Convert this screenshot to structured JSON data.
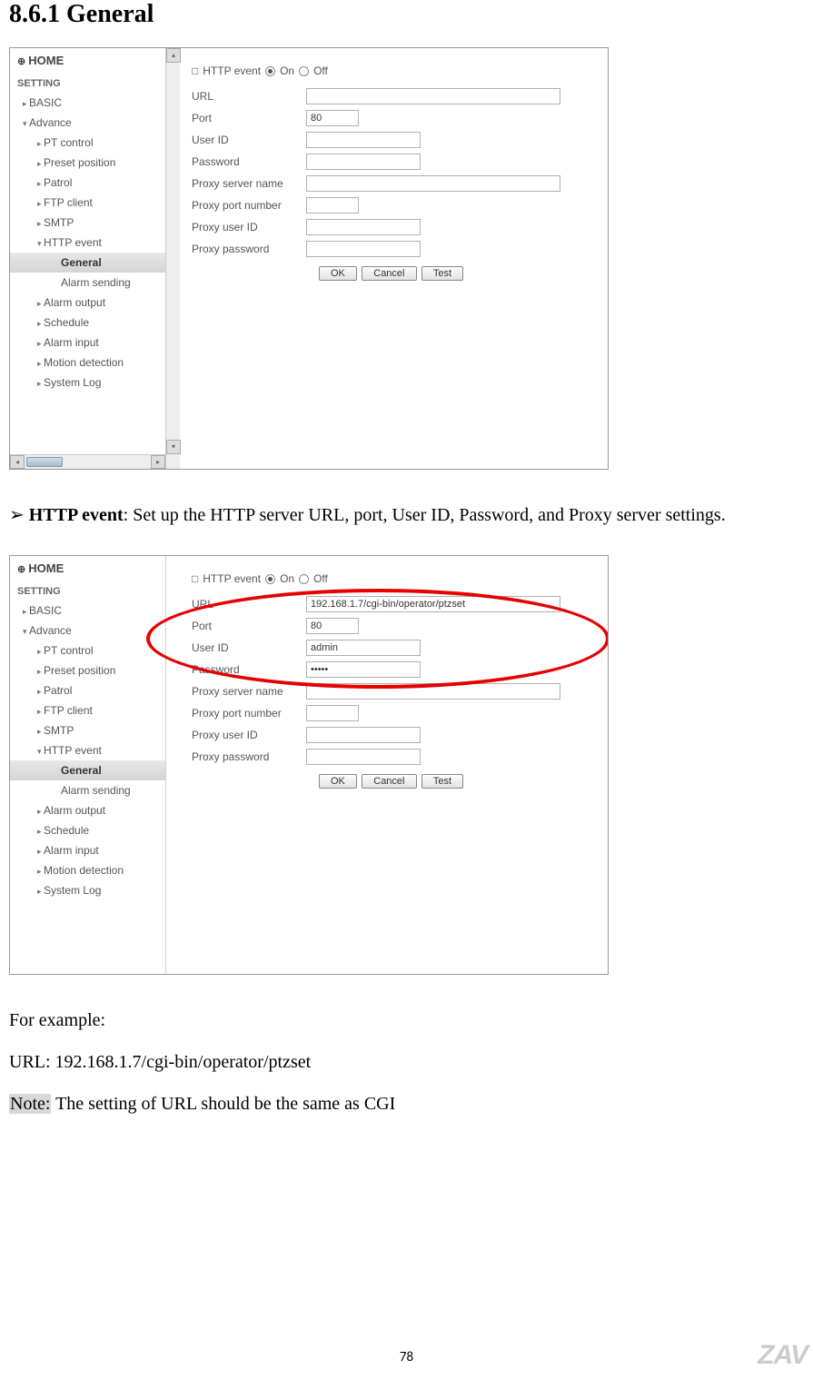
{
  "heading": "8.6.1 General",
  "sidebar": {
    "home": "HOME",
    "section": "SETTING",
    "items": [
      {
        "label": "BASIC",
        "cls": "nav-arrow"
      },
      {
        "label": "Advance",
        "cls": "nav-open"
      },
      {
        "label": "PT control",
        "cls": "nav-arrow lvl2"
      },
      {
        "label": "Preset position",
        "cls": "nav-arrow lvl2"
      },
      {
        "label": "Patrol",
        "cls": "nav-arrow lvl2"
      },
      {
        "label": "FTP client",
        "cls": "nav-arrow lvl2"
      },
      {
        "label": "SMTP",
        "cls": "nav-arrow lvl2"
      },
      {
        "label": "HTTP event",
        "cls": "nav-open lvl2"
      },
      {
        "label": "General",
        "cls": "lvl3 selected"
      },
      {
        "label": "Alarm sending",
        "cls": "lvl3"
      },
      {
        "label": "Alarm output",
        "cls": "nav-arrow lvl2"
      },
      {
        "label": "Schedule",
        "cls": "nav-arrow lvl2"
      },
      {
        "label": "Alarm input",
        "cls": "nav-arrow lvl2"
      },
      {
        "label": "Motion detection",
        "cls": "nav-arrow lvl2"
      },
      {
        "label": "System Log",
        "cls": "nav-arrow lvl2"
      }
    ]
  },
  "form": {
    "title": "HTTP event",
    "on": "On",
    "off": "Off",
    "url": "URL",
    "port": "Port",
    "port_val": "80",
    "user_id": "User ID",
    "password": "Password",
    "proxy_name": "Proxy server name",
    "proxy_port": "Proxy port number",
    "proxy_user": "Proxy user ID",
    "proxy_pw": "Proxy password",
    "ok": "OK",
    "cancel": "Cancel",
    "test": "Test"
  },
  "form2": {
    "url_val": "192.168.1.7/cgi-bin/operator/ptzset",
    "port_val": "80",
    "user_val": "admin",
    "pw_val": "•••••"
  },
  "text": {
    "desc_pre": "➢ ",
    "desc_bold": "HTTP event",
    "desc_rest": ": Set up the HTTP server URL, port, User ID, Password, and Proxy server settings.",
    "for_example": "For example:",
    "url_example": "URL: 192.168.1.7/cgi-bin/operator/ptzset",
    "note_label": "Note:",
    "note_rest": " The setting of URL should be the same as CGI"
  },
  "page_number": "78",
  "watermark": "ZAV"
}
